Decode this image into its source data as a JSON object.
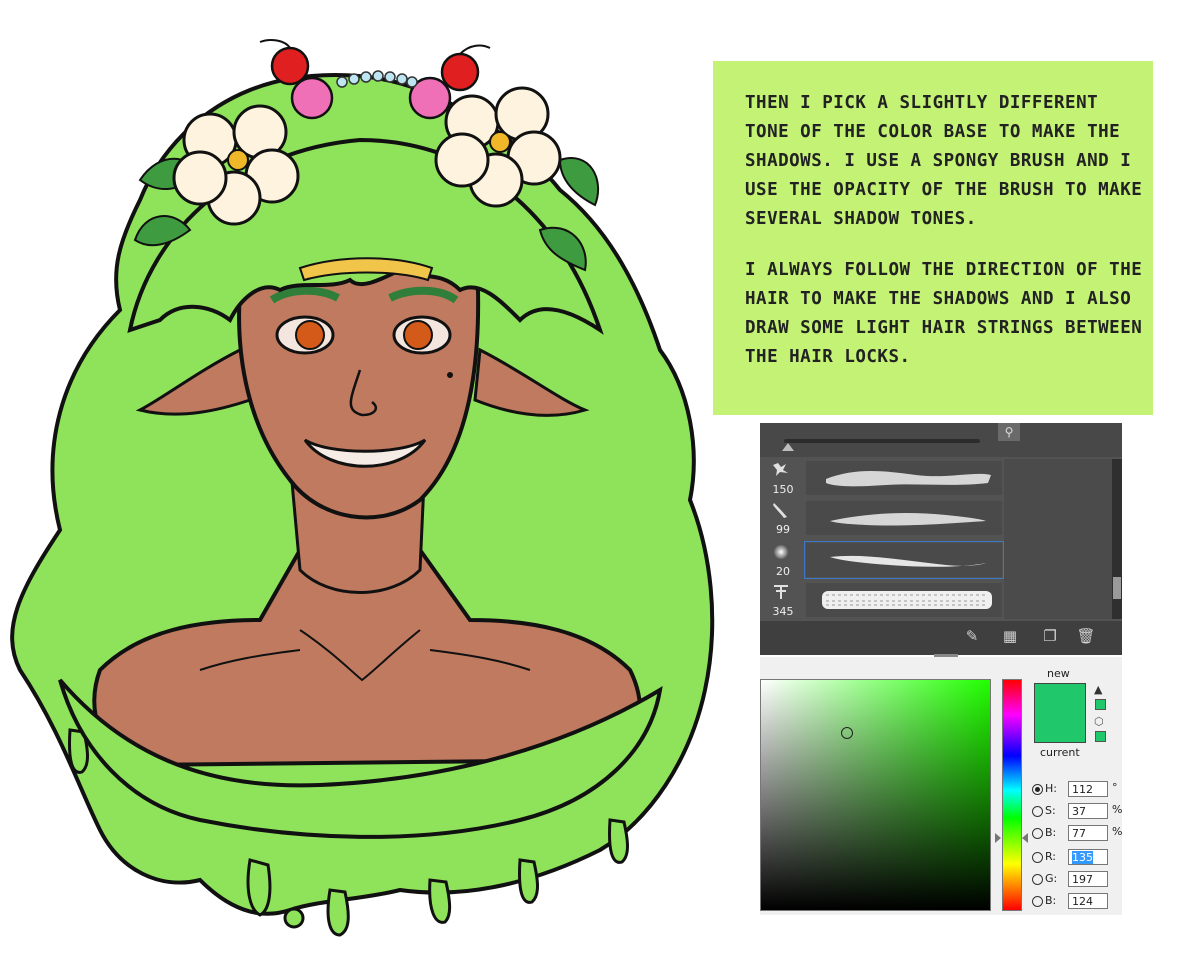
{
  "instructions": {
    "paragraph1": "Then I pick a slightly different tone of the color base to make the shadows. I use a spongy brush and I use the opacity of the brush to make several shadow tones.",
    "paragraph2": "I always follow the direction of the hair to make the shadows and I also draw some light hair strings between the hair locks."
  },
  "brush_panel": {
    "brushes": [
      {
        "size": "150",
        "icon": "splatter-brush-icon"
      },
      {
        "size": "99",
        "icon": "chalk-brush-icon"
      },
      {
        "size": "20",
        "icon": "soft-round-brush-icon",
        "selected": true
      },
      {
        "size": "345",
        "icon": "grass-brush-icon"
      }
    ]
  },
  "color_picker": {
    "new_label": "new",
    "current_label": "current",
    "new_color": "#21c76b",
    "fields": [
      {
        "label": "H:",
        "value": "112",
        "unit": "°",
        "selected": true
      },
      {
        "label": "S:",
        "value": "37",
        "unit": "%"
      },
      {
        "label": "B:",
        "value": "77",
        "unit": "%"
      },
      {
        "label": "R:",
        "value": "135",
        "unit": "",
        "highlighted": true
      },
      {
        "label": "G:",
        "value": "197",
        "unit": ""
      },
      {
        "label": "B:",
        "value": "124",
        "unit": ""
      }
    ]
  },
  "colors": {
    "note_background": "#c3f275",
    "hair_green": "#8ee65a",
    "skin": "#c07a60"
  }
}
